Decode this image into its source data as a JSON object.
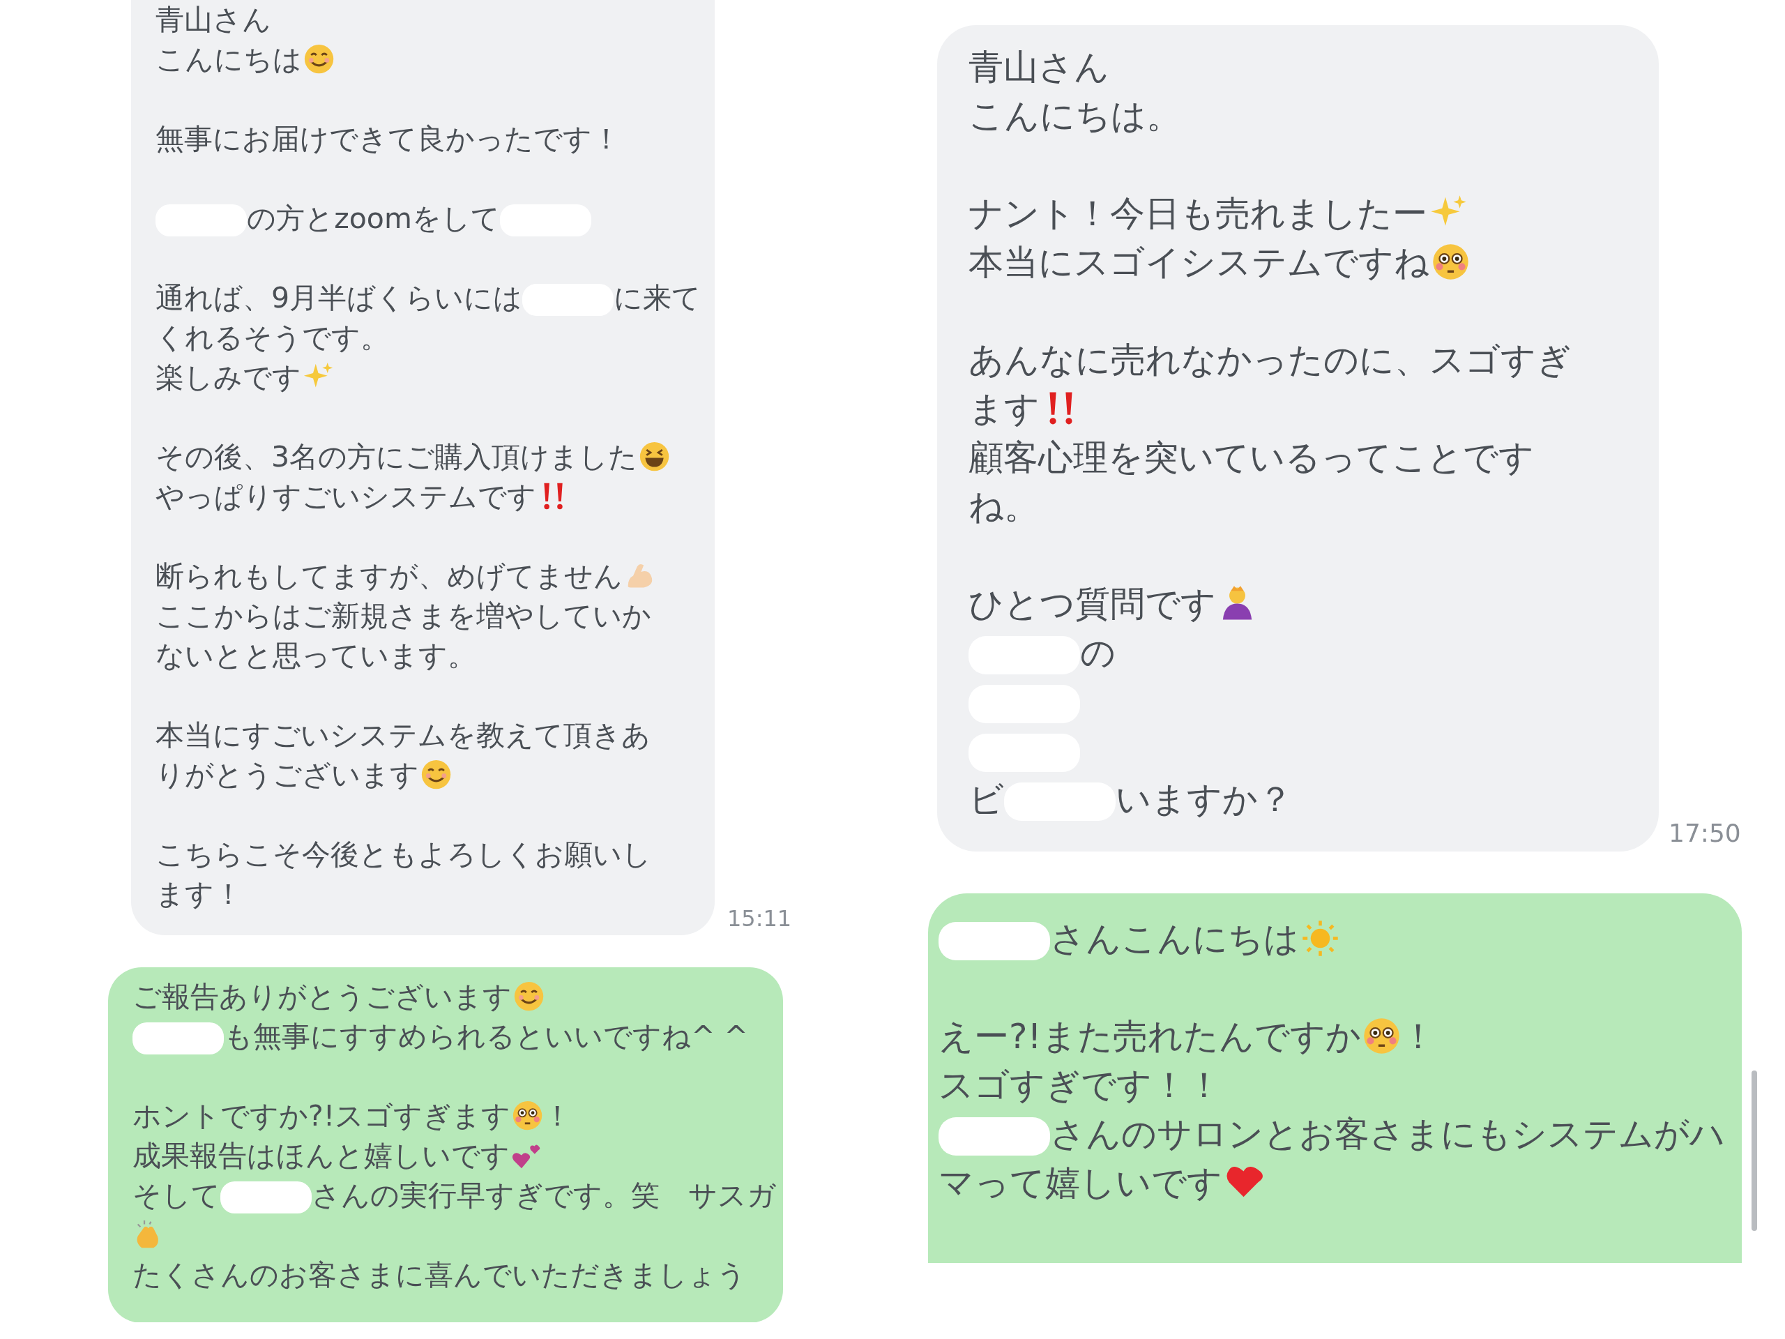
{
  "panels": [
    {
      "messages": [
        {
          "kind": "received",
          "time": "15:11",
          "paragraphs": [
            [
              [
                {
                  "kind": "text",
                  "text": "青山さん"
                }
              ],
              [
                {
                  "kind": "text",
                  "text": "こんにちは"
                },
                {
                  "kind": "smile"
                }
              ]
            ],
            [
              [
                {
                  "kind": "text",
                  "text": "無事にお届けできて良かったです！"
                }
              ]
            ],
            [
              [
                {
                  "kind": "redacted"
                },
                {
                  "kind": "text",
                  "text": "の方とzoomをして"
                },
                {
                  "kind": "redacted"
                }
              ]
            ],
            [
              [
                {
                  "kind": "text",
                  "text": "通れば、9月半ばくらいには"
                },
                {
                  "kind": "redacted"
                },
                {
                  "kind": "text",
                  "text": "に来て"
                }
              ],
              [
                {
                  "kind": "text",
                  "text": "くれるそうです。"
                }
              ],
              [
                {
                  "kind": "text",
                  "text": "楽しみです"
                },
                {
                  "kind": "sparkles"
                }
              ]
            ],
            [
              [
                {
                  "kind": "text",
                  "text": "その後、3名の方にご購入頂けました"
                },
                {
                  "kind": "grin"
                }
              ],
              [
                {
                  "kind": "text",
                  "text": "やっぱりすごいシステムです"
                },
                {
                  "kind": "bangbang"
                }
              ]
            ],
            [
              [
                {
                  "kind": "text",
                  "text": "断られもしてますが、めげてません"
                },
                {
                  "kind": "muscle"
                }
              ],
              [
                {
                  "kind": "text",
                  "text": "ここからはご新規さまを増やしていか"
                }
              ],
              [
                {
                  "kind": "text",
                  "text": "ないとと思っています。"
                }
              ]
            ],
            [
              [
                {
                  "kind": "text",
                  "text": "本当にすごいシステムを教えて頂きあ"
                }
              ],
              [
                {
                  "kind": "text",
                  "text": "りがとうございます"
                },
                {
                  "kind": "smile"
                }
              ]
            ],
            [
              [
                {
                  "kind": "text",
                  "text": "こちらこそ今後ともよろしくお願いし"
                }
              ],
              [
                {
                  "kind": "text",
                  "text": "ます！"
                }
              ]
            ]
          ]
        },
        {
          "kind": "sent",
          "paragraphs": [
            [
              [
                {
                  "kind": "text",
                  "text": "ご報告ありがとうございます"
                },
                {
                  "kind": "smile"
                }
              ],
              [
                {
                  "kind": "redacted"
                },
                {
                  "kind": "text",
                  "text": "も無事にすすめられるといいですね^ ^"
                }
              ]
            ],
            [
              [
                {
                  "kind": "text",
                  "text": "ホントですか?!スゴすぎます"
                },
                {
                  "kind": "flushed"
                },
                {
                  "kind": "text",
                  "text": "！"
                }
              ],
              [
                {
                  "kind": "text",
                  "text": "成果報告はほんと嬉しいです"
                },
                {
                  "kind": "hearts"
                }
              ],
              [
                {
                  "kind": "text",
                  "text": "そして"
                },
                {
                  "kind": "redacted"
                },
                {
                  "kind": "text",
                  "text": "さんの実行早すぎです。笑　サスガ"
                }
              ],
              [
                {
                  "kind": "clap"
                }
              ],
              [
                {
                  "kind": "text",
                  "text": "たくさんのお客さまに喜んでいただきましょう"
                }
              ]
            ]
          ]
        }
      ]
    },
    {
      "messages": [
        {
          "kind": "received",
          "time": "17:50",
          "paragraphs": [
            [
              [
                {
                  "kind": "text",
                  "text": "青山さん"
                }
              ],
              [
                {
                  "kind": "text",
                  "text": "こんにちは。"
                }
              ]
            ],
            [
              [
                {
                  "kind": "text",
                  "text": "ナント！今日も売れましたー"
                },
                {
                  "kind": "sparkles"
                }
              ],
              [
                {
                  "kind": "text",
                  "text": "本当にスゴイシステムですね"
                },
                {
                  "kind": "flushed"
                }
              ]
            ],
            [
              [
                {
                  "kind": "text",
                  "text": "あんなに売れなかったのに、スゴすぎ"
                }
              ],
              [
                {
                  "kind": "text",
                  "text": "ます"
                },
                {
                  "kind": "bangbang"
                }
              ],
              [
                {
                  "kind": "text",
                  "text": "顧客心理を突いているってことです"
                }
              ],
              [
                {
                  "kind": "text",
                  "text": "ね。"
                }
              ]
            ],
            [
              [
                {
                  "kind": "text",
                  "text": "ひとつ質問です"
                },
                {
                  "kind": "bowing"
                }
              ],
              [
                {
                  "kind": "redacted"
                },
                {
                  "kind": "text",
                  "text": "の"
                }
              ],
              [
                {
                  "kind": "redacted"
                }
              ],
              [
                {
                  "kind": "redacted"
                }
              ],
              [
                {
                  "kind": "text",
                  "text": "ビ"
                },
                {
                  "kind": "redacted"
                },
                {
                  "kind": "text",
                  "text": "いますか？"
                }
              ]
            ]
          ]
        },
        {
          "kind": "sent",
          "paragraphs": [
            [
              [
                {
                  "kind": "redacted"
                },
                {
                  "kind": "text",
                  "text": "さんこんにちは"
                },
                {
                  "kind": "sun"
                }
              ]
            ],
            [
              [
                {
                  "kind": "text",
                  "text": "えー?!また売れたんですか"
                },
                {
                  "kind": "flushed"
                },
                {
                  "kind": "text",
                  "text": "！"
                }
              ],
              [
                {
                  "kind": "text",
                  "text": "スゴすぎです！！"
                }
              ],
              [
                {
                  "kind": "redacted"
                },
                {
                  "kind": "text",
                  "text": "さんのサロンとお客さまにもシステムがハ"
                }
              ],
              [
                {
                  "kind": "text",
                  "text": "マって嬉しいです"
                },
                {
                  "kind": "heart"
                }
              ]
            ]
          ]
        }
      ]
    }
  ]
}
